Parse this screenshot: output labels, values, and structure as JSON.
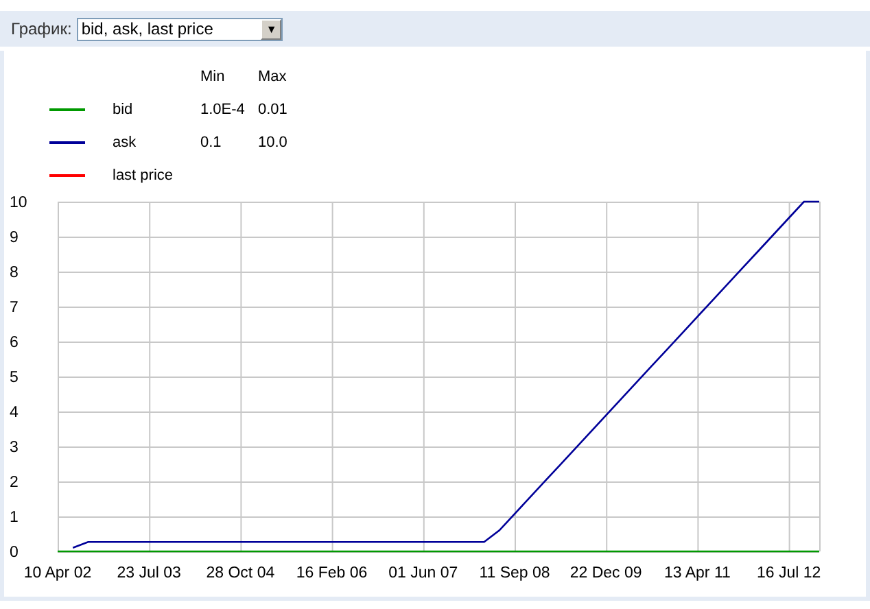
{
  "toolbar": {
    "label": "График:",
    "select": {
      "value": "bid, ask, last price",
      "arrow": "▼"
    }
  },
  "legend": {
    "columns": [
      "Min",
      "Max"
    ],
    "items": [
      {
        "min": "1.0E-4",
        "max": "0.01"
      },
      {
        "min": "0.1",
        "max": "10.0"
      }
    ]
  },
  "chart": {
    "chart_data": {
      "type": "line",
      "grid": true,
      "categories": [
        "10 Apr 02",
        null,
        null,
        null,
        null,
        null,
        "23 Jul 03",
        null,
        null,
        null,
        null,
        null,
        "28 Oct 04",
        null,
        null,
        null,
        null,
        null,
        "16 Feb 06",
        null,
        null,
        null,
        null,
        null,
        "01 Jun 07",
        null,
        null,
        null,
        null,
        null,
        "11 Sep 08",
        null,
        null,
        null,
        null,
        null,
        "22 Dec 09",
        null,
        null,
        null,
        null,
        null,
        "13 Apr 11",
        null,
        null,
        null,
        null,
        null,
        "16 Jul 12",
        null,
        null
      ],
      "series": [
        {
          "name": "bid",
          "color": "#009900",
          "values": [
            0,
            0,
            0,
            0,
            0,
            0,
            0,
            0,
            0,
            0,
            0,
            0,
            0,
            0,
            0,
            0,
            0,
            0,
            0,
            0,
            0,
            0,
            0,
            0,
            0,
            0,
            0,
            0,
            0,
            0,
            0,
            0,
            0,
            0,
            0,
            0,
            0,
            0,
            0,
            0,
            0,
            0,
            0,
            0,
            0,
            0,
            0,
            0,
            0,
            0,
            0
          ]
        },
        {
          "name": "ask",
          "color": "#000099",
          "values": [
            null,
            0.1,
            0.27,
            0.27,
            0.27,
            0.27,
            0.27,
            0.27,
            0.27,
            0.27,
            0.27,
            0.27,
            0.27,
            0.27,
            0.27,
            0.27,
            0.27,
            0.27,
            0.27,
            0.27,
            0.27,
            0.27,
            0.27,
            0.27,
            0.27,
            0.27,
            0.27,
            0.27,
            0.27,
            0.6,
            1.07,
            1.54,
            2.01,
            2.48,
            2.95,
            3.42,
            3.89,
            4.36,
            4.83,
            5.3,
            5.77,
            6.24,
            6.71,
            7.18,
            7.65,
            8.12,
            8.59,
            9.06,
            9.53,
            10,
            10
          ]
        },
        {
          "name": "last price",
          "color": "#ff0000",
          "values": [
            null,
            null,
            null,
            null,
            null,
            null,
            null,
            null,
            null,
            null,
            null,
            null,
            null,
            null,
            null,
            null,
            null,
            null,
            null,
            null,
            null,
            null,
            null,
            null,
            null,
            null,
            null,
            null,
            null,
            null,
            null,
            null,
            null,
            null,
            null,
            null,
            null,
            null,
            null,
            null,
            null,
            null,
            null,
            null,
            null,
            null,
            null,
            null,
            null,
            null,
            null
          ]
        }
      ],
      "ylim": [
        0,
        10
      ],
      "yticks": [
        0,
        1,
        2,
        3,
        4,
        5,
        6,
        7,
        8,
        9,
        10
      ]
    }
  }
}
